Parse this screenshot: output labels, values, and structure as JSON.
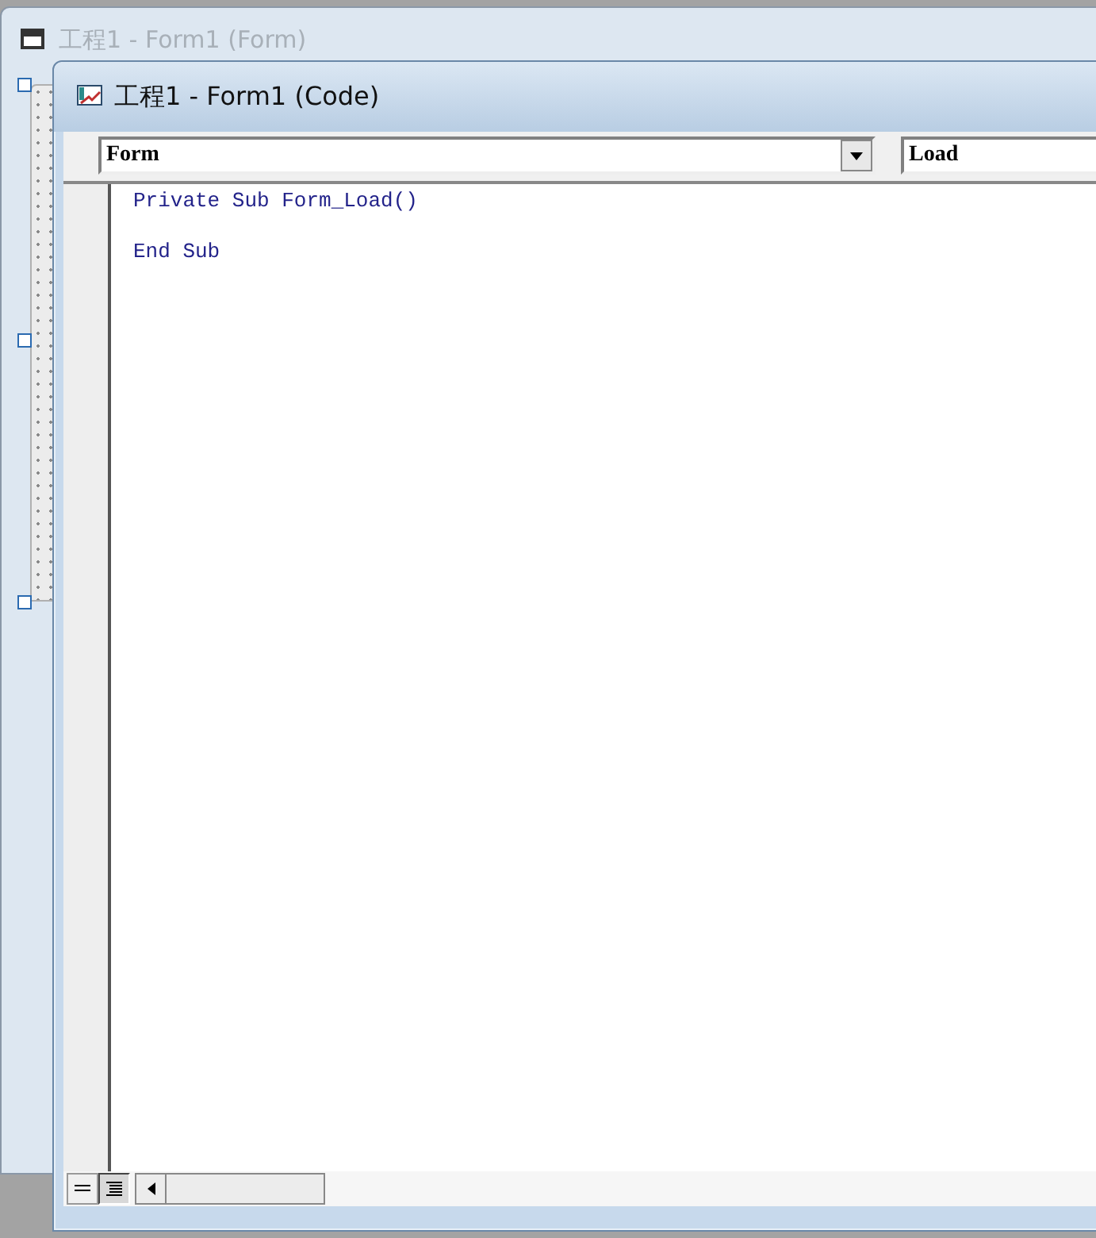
{
  "back_window": {
    "title": "工程1 - Form1 (Form)"
  },
  "code_window": {
    "title": "工程1 - Form1 (Code)",
    "object_combo": {
      "value": "Form"
    },
    "procedure_combo": {
      "value": "Load"
    },
    "code_lines": [
      "Private Sub Form_Load()",
      "End Sub"
    ],
    "view_buttons": [
      {
        "selected": false
      },
      {
        "selected": true
      }
    ]
  }
}
